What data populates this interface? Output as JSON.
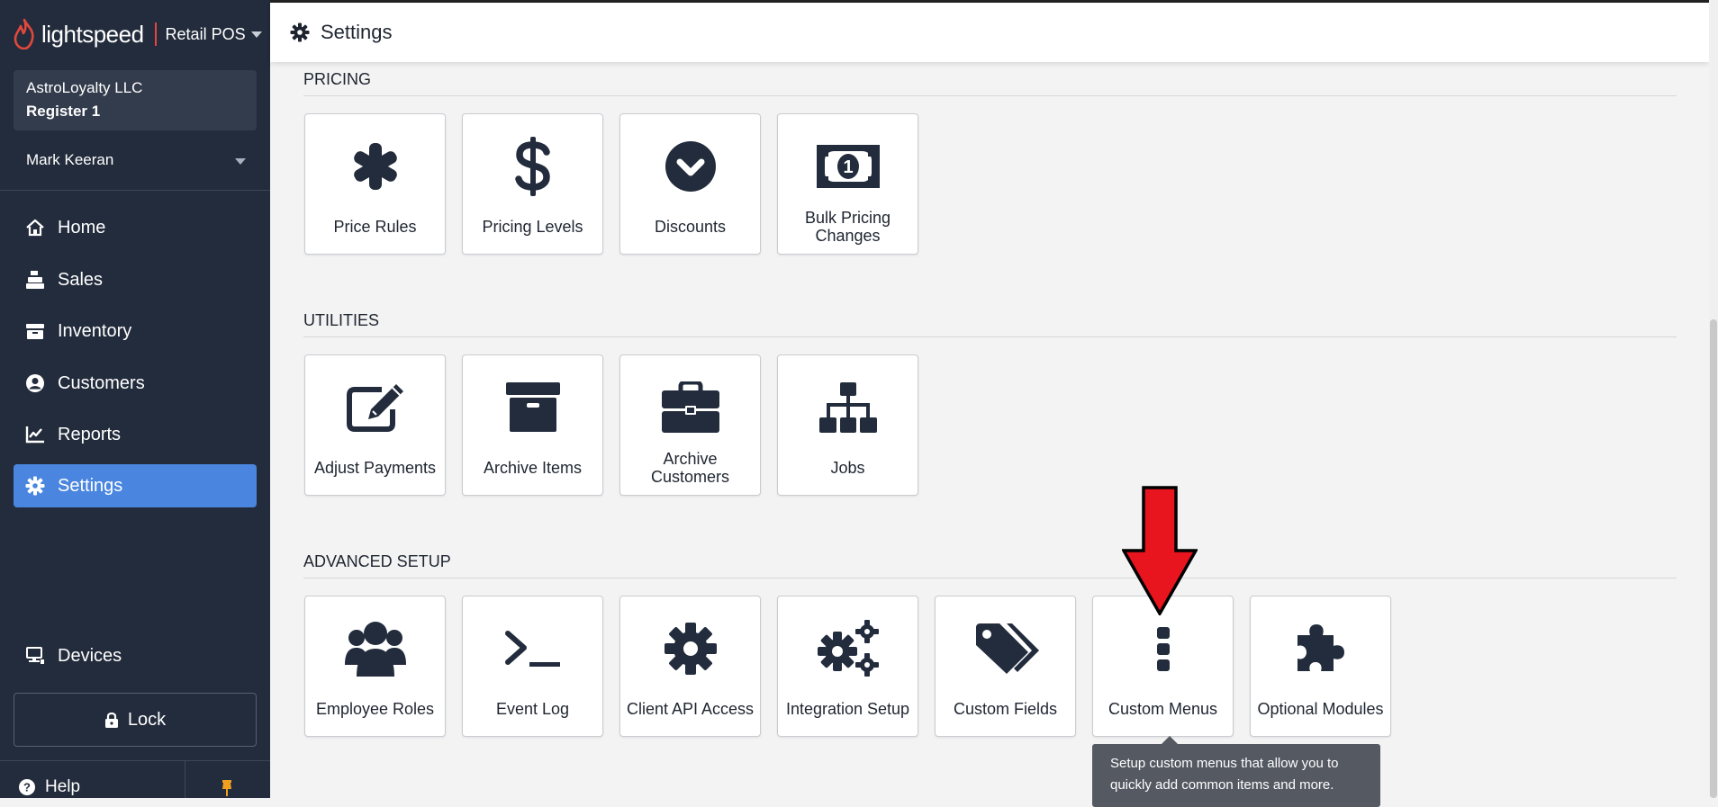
{
  "app": {
    "brand": "lightspeed",
    "product": "Retail POS",
    "accent_color": "#4a86e0",
    "brand_color": "#e2483d",
    "sidebar_color": "#232c3c"
  },
  "sidebar": {
    "store_name": "AstroLoyalty LLC",
    "register": "Register 1",
    "user_name": "Mark Keeran",
    "nav": [
      {
        "label": "Home",
        "icon": "home-icon"
      },
      {
        "label": "Sales",
        "icon": "register-icon"
      },
      {
        "label": "Inventory",
        "icon": "inventory-icon"
      },
      {
        "label": "Customers",
        "icon": "customer-icon"
      },
      {
        "label": "Reports",
        "icon": "chart-icon"
      },
      {
        "label": "Settings",
        "icon": "gear-icon",
        "active": true
      }
    ],
    "devices_label": "Devices",
    "lock_label": "Lock",
    "help_label": "Help"
  },
  "header": {
    "title": "Settings"
  },
  "sections": {
    "pricing": {
      "title": "PRICING",
      "tiles": [
        {
          "label": "Price Rules",
          "icon": "asterisk-icon"
        },
        {
          "label": "Pricing Levels",
          "icon": "dollar-icon"
        },
        {
          "label": "Discounts",
          "icon": "chevron-circle-icon"
        },
        {
          "label": "Bulk Pricing Changes",
          "icon": "banknote-icon"
        }
      ]
    },
    "utilities": {
      "title": "UTILITIES",
      "tiles": [
        {
          "label": "Adjust Payments",
          "icon": "edit-icon"
        },
        {
          "label": "Archive Items",
          "icon": "archive-box-icon"
        },
        {
          "label": "Archive Customers",
          "icon": "briefcase-icon"
        },
        {
          "label": "Jobs",
          "icon": "sitemap-icon"
        }
      ]
    },
    "advanced": {
      "title": "ADVANCED SETUP",
      "tiles": [
        {
          "label": "Employee Roles",
          "icon": "users-icon"
        },
        {
          "label": "Event Log",
          "icon": "terminal-icon"
        },
        {
          "label": "Client API Access",
          "icon": "cog-icon"
        },
        {
          "label": "Integration Setup",
          "icon": "cogs-icon"
        },
        {
          "label": "Custom Fields",
          "icon": "tags-icon"
        },
        {
          "label": "Custom Menus",
          "icon": "vertical-dots-icon"
        },
        {
          "label": "Optional Modules",
          "icon": "puzzle-icon"
        }
      ]
    }
  },
  "tooltip": {
    "text": "Setup custom menus that allow you to quickly add common items and more."
  },
  "annotation": {
    "arrow_color": "#e8141e"
  }
}
